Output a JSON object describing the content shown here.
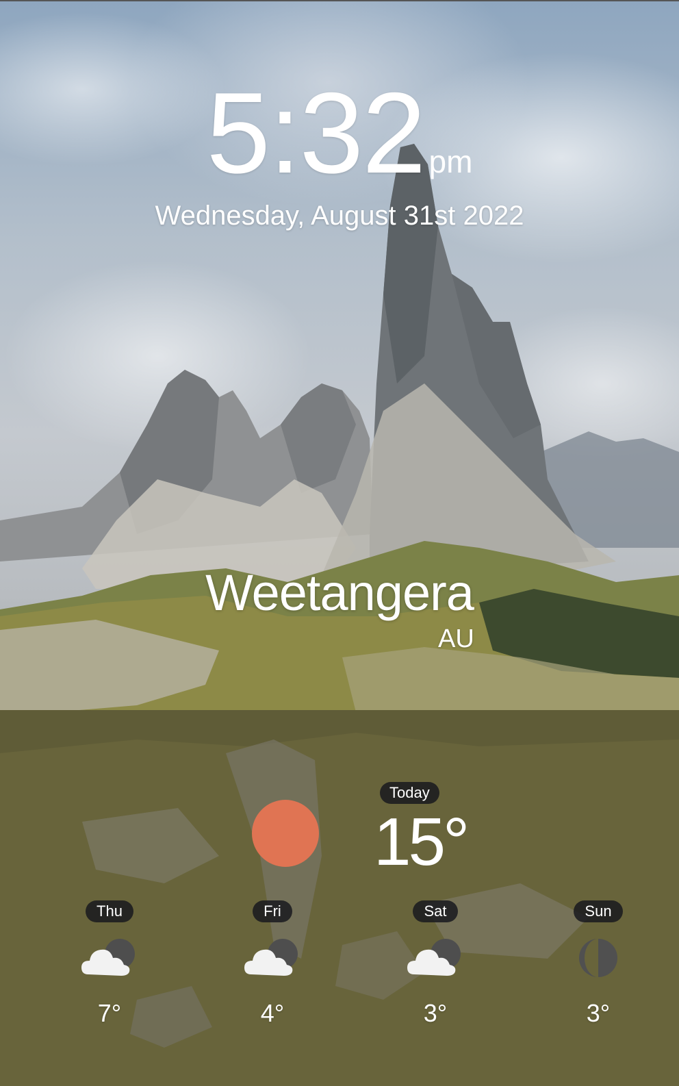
{
  "clock": {
    "time": "5:32",
    "ampm": "pm",
    "date": "Wednesday, August 31st 2022"
  },
  "location": {
    "city": "Weetangera",
    "country": "AU"
  },
  "today": {
    "label": "Today",
    "temperature": "15°",
    "icon": "sun-icon",
    "icon_color": "#e07453"
  },
  "forecast": [
    {
      "day": "Thu",
      "icon": "cloud-night-icon",
      "temperature": "7°"
    },
    {
      "day": "Fri",
      "icon": "cloud-night-icon",
      "temperature": "4°"
    },
    {
      "day": "Sat",
      "icon": "cloud-night-icon",
      "temperature": "3°"
    },
    {
      "day": "Sun",
      "icon": "moon-icon",
      "temperature": "3°"
    }
  ],
  "colors": {
    "badge_bg": "#1c1c22",
    "text": "#ffffff",
    "sun": "#e07453",
    "cloud": "#f2f2f2",
    "moon": "#505050"
  }
}
